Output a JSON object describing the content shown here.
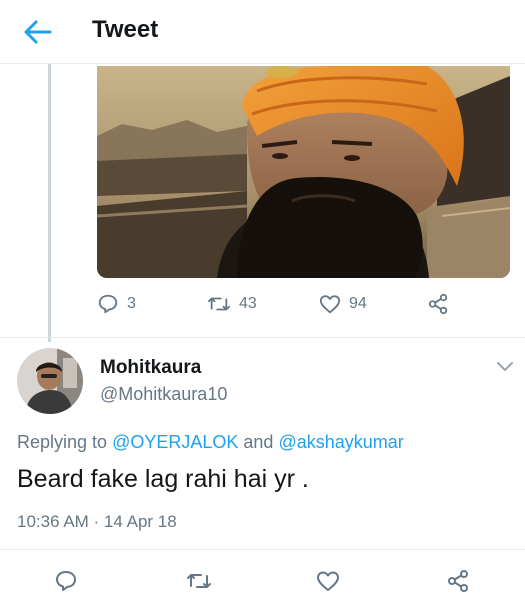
{
  "header": {
    "title": "Tweet"
  },
  "parent_tweet": {
    "stats": {
      "replies": "3",
      "retweets": "43",
      "likes": "94"
    }
  },
  "reply": {
    "display_name": "Mohitkaura",
    "handle": "@Mohitkaura10",
    "replying_prefix": "Replying to",
    "mention_1": "@OYERJALOK",
    "replying_and": "and",
    "mention_2": "@akshaykumar",
    "text": "Beard fake lag rahi hai yr .",
    "timestamp": "10:36 AM · 14 Apr 18"
  },
  "colors": {
    "accent": "#1da1f2",
    "text_primary": "#14171a",
    "text_secondary": "#657786",
    "icon": "#657786",
    "divider": "#e6ecf0"
  },
  "icons": {
    "back": "arrow-left-icon",
    "reply": "reply-icon",
    "retweet": "retweet-icon",
    "like": "heart-icon",
    "share": "share-icon",
    "more": "chevron-down-icon"
  }
}
